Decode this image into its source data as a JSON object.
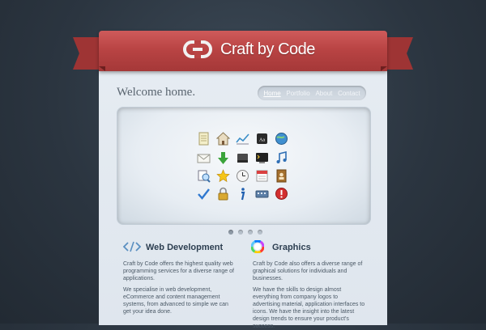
{
  "brand": {
    "name_part1": "Craft",
    "name_part2": " by ",
    "name_part3": "Code",
    "ribbon_color": "#b94444"
  },
  "header": {
    "welcome": "Welcome home."
  },
  "nav": {
    "items": [
      {
        "label": "Home",
        "active": true
      },
      {
        "label": "Portfolio",
        "active": false
      },
      {
        "label": "About",
        "active": false
      },
      {
        "label": "Contact",
        "active": false
      }
    ]
  },
  "slider": {
    "icons": [
      [
        "notepad-icon",
        "home-icon",
        "chart-icon",
        "dictionary-icon",
        "globe-icon"
      ],
      [
        "mail-icon",
        "download-icon",
        "harddrive-icon",
        "terminal-icon",
        "music-note-icon"
      ],
      [
        "preview-icon",
        "star-icon",
        "clock-icon",
        "calendar-icon",
        "address-book-icon"
      ],
      [
        "checkmark-icon",
        "lock-icon",
        "info-icon",
        "keyboard-icon",
        "alert-icon"
      ]
    ],
    "dots": 4,
    "active_dot": 0
  },
  "sections": {
    "web": {
      "icon": "code-icon",
      "title": "Web Development",
      "p1": "Craft by Code offers the highest quality web programming services for a diverse range of applications.",
      "p2": "We specialise in web development, eCommerce and content management systems, from advanced to simple we can get your idea done."
    },
    "graphics": {
      "icon": "color-wheel-icon",
      "title": "Graphics",
      "p1": "Craft by Code also offers a diverse range of graphical solutions for individuals and businesses.",
      "p2": "We have the skills to design almost everything from company logos to advertising material, application interfaces to icons. We have the insight into the latest design trends to ensure your product's success."
    }
  }
}
